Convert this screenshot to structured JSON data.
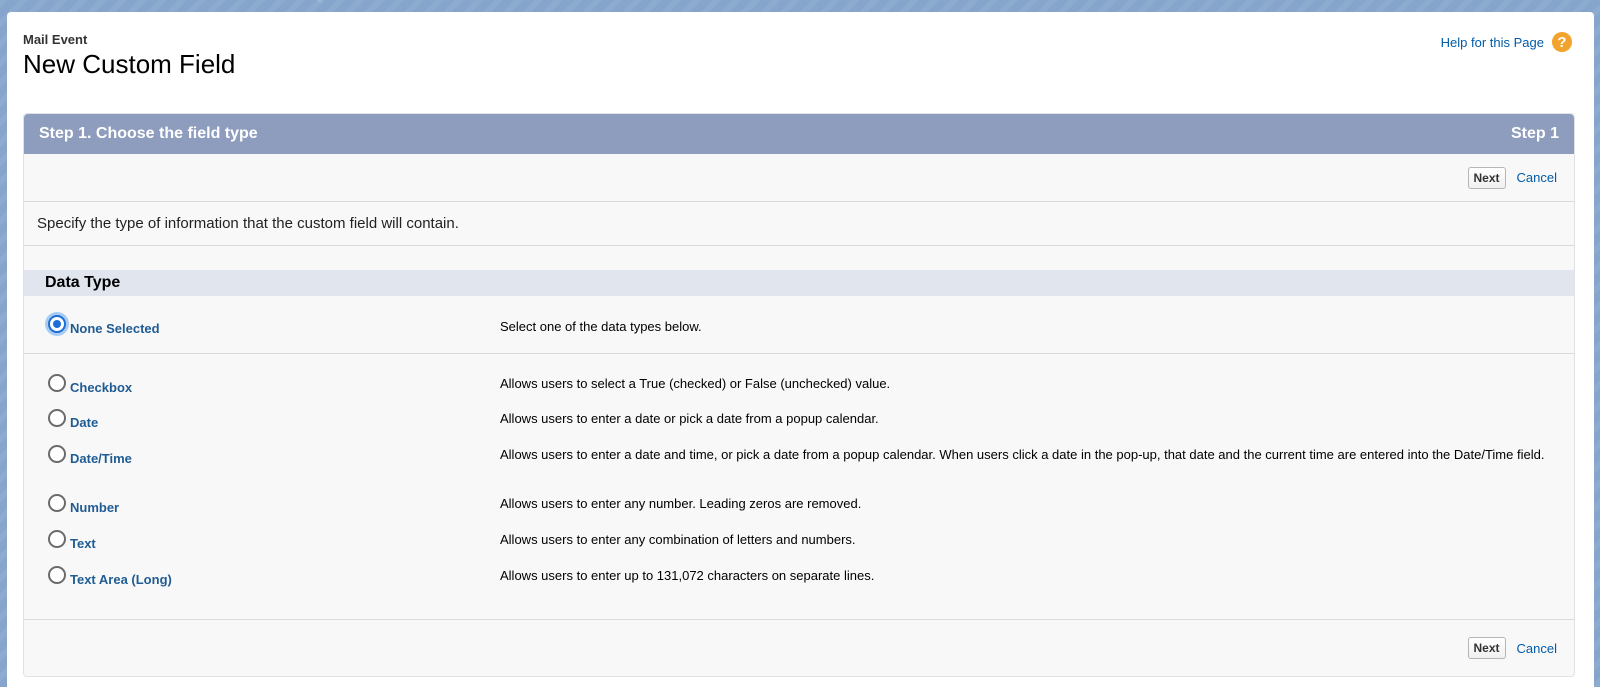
{
  "header": {
    "object_label": "Mail Event",
    "title": "New Custom Field",
    "help_link": "Help for this Page",
    "help_icon": "?"
  },
  "panel": {
    "title": "Step 1. Choose the field type",
    "step": "Step 1",
    "next_label": "Next",
    "cancel_label": "Cancel",
    "intro": "Specify the type of information that the custom field will contain.",
    "section_title": "Data Type"
  },
  "options": [
    {
      "label": "None Selected",
      "desc": "Select one of the data types below.",
      "checked": true
    },
    {
      "label": "Checkbox",
      "desc": "Allows users to select a True (checked) or False (unchecked) value."
    },
    {
      "label": "Date",
      "desc": "Allows users to enter a date or pick a date from a popup calendar."
    },
    {
      "label": "Date/Time",
      "desc": "Allows users to enter a date and time, or pick a date from a popup calendar. When users click a date in the pop-up, that date and the current time are entered into the Date/Time field."
    },
    {
      "label": "Number",
      "desc": "Allows users to enter any number. Leading zeros are removed."
    },
    {
      "label": "Text",
      "desc": "Allows users to enter any combination of letters and numbers."
    },
    {
      "label": "Text Area (Long)",
      "desc": "Allows users to enter up to 131,072 characters on separate lines."
    }
  ],
  "colors": {
    "panel_header": "#8e9dbe",
    "link": "#015ba7",
    "section_header": "#e0e5ee"
  }
}
